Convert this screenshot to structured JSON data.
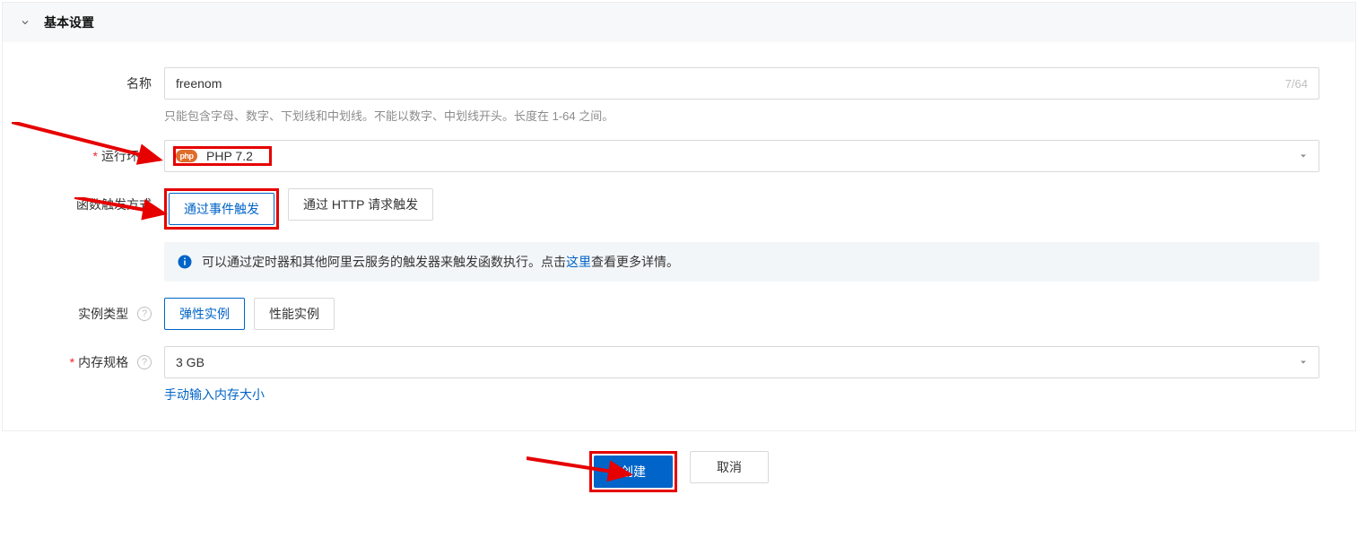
{
  "panel": {
    "title": "基本设置"
  },
  "name": {
    "label": "名称",
    "value": "freenom",
    "counter": "7/64",
    "hint": "只能包含字母、数字、下划线和中划线。不能以数字、中划线开头。长度在 1-64 之间。"
  },
  "runtime": {
    "label": "运行环境",
    "badge": "php",
    "value": "PHP 7.2"
  },
  "trigger": {
    "label": "函数触发方式",
    "options": [
      {
        "label": "通过事件触发",
        "selected": true
      },
      {
        "label": "通过 HTTP 请求触发",
        "selected": false
      }
    ],
    "alert_prefix": "可以通过定时器和其他阿里云服务的触发器来触发函数执行。点击",
    "alert_link": "这里",
    "alert_suffix": "查看更多详情。"
  },
  "instance_type": {
    "label": "实例类型",
    "options": [
      {
        "label": "弹性实例",
        "selected": true
      },
      {
        "label": "性能实例",
        "selected": false
      }
    ]
  },
  "memory": {
    "label": "内存规格",
    "value": "3 GB",
    "manual_link": "手动输入内存大小"
  },
  "footer": {
    "create": "创建",
    "cancel": "取消"
  },
  "help_glyph": "?"
}
